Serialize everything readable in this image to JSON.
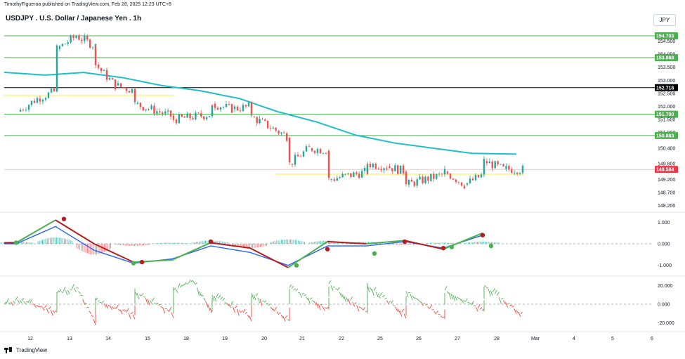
{
  "header": {
    "published": "TimothyFigueroa published on TradingView.com, Feb 28, 2025 12:23 UTC+8"
  },
  "chart_title": "USDJPY . U.S. Dollar / Japanese Yen . 1h",
  "currency_button": "JPY",
  "footer": {
    "brand": "TradingView"
  },
  "colors": {
    "up": "#26a69a",
    "down": "#ef5350",
    "ma": "#1fbfc9",
    "level_green": "#4caf50",
    "level_black": "#000000",
    "current_price": "#f23645",
    "macd_fast": "#2962ff",
    "macd_green": "#4caf50",
    "macd_red": "#b71c1c",
    "zone_yellow": "#fff59d",
    "osc_green": "#4caf50",
    "osc_red": "#f44336"
  },
  "chart_data": [
    {
      "type": "candlestick",
      "symbol": "USDJPY",
      "timeframe": "1h",
      "x_tick_labels": [
        "12",
        "13",
        "14",
        "15",
        "18",
        "19",
        "20",
        "21",
        "22",
        "25",
        "26",
        "27",
        "28",
        "Mar",
        "4",
        "5",
        "6"
      ],
      "y_tick_labels": [
        "154.500",
        "154.000",
        "153.500",
        "153.000",
        "152.500",
        "152.000",
        "151.500",
        "151.000",
        "150.400",
        "149.800",
        "149.200",
        "148.700",
        "148.200"
      ],
      "ylim": [
        148.0,
        155.0
      ],
      "price_levels": [
        {
          "label": "154.703",
          "value": 154.703,
          "color": "green"
        },
        {
          "label": "153.868",
          "value": 153.868,
          "color": "green"
        },
        {
          "label": "152.718",
          "value": 152.718,
          "color": "black"
        },
        {
          "label": "151.700",
          "value": 151.7,
          "color": "green"
        },
        {
          "label": "150.883",
          "value": 150.883,
          "color": "green"
        },
        {
          "label": "149.584",
          "value": 149.584,
          "color": "current"
        }
      ],
      "zones": [
        {
          "from_day": "12",
          "to_day": "15",
          "value": 152.42
        },
        {
          "from_day": "21",
          "to_day": "28",
          "value": 149.4
        }
      ],
      "close_path": [
        [
          "12",
          151.8
        ],
        [
          "12",
          152.3
        ],
        [
          "12",
          152.6
        ],
        [
          "13",
          154.2
        ],
        [
          "13",
          154.7
        ],
        [
          "13",
          154.3
        ],
        [
          "14",
          153.6
        ],
        [
          "14",
          152.8
        ],
        [
          "14",
          152.6
        ],
        [
          "15",
          152.1
        ],
        [
          "15",
          151.6
        ],
        [
          "18",
          151.5
        ],
        [
          "18",
          151.7
        ],
        [
          "19",
          152.1
        ],
        [
          "19",
          151.9
        ],
        [
          "19",
          152.0
        ],
        [
          "20",
          151.6
        ],
        [
          "20",
          150.8
        ],
        [
          "21",
          149.8
        ],
        [
          "21",
          150.4
        ],
        [
          "21",
          150.3
        ],
        [
          "22",
          149.2
        ],
        [
          "22",
          149.5
        ],
        [
          "25",
          149.8
        ],
        [
          "25",
          149.7
        ],
        [
          "25",
          149.5
        ],
        [
          "26",
          149.0
        ],
        [
          "26",
          149.4
        ],
        [
          "27",
          149.5
        ],
        [
          "27",
          149.0
        ],
        [
          "27",
          149.4
        ],
        [
          "28",
          149.9
        ],
        [
          "28",
          149.6
        ],
        [
          "28",
          149.58
        ]
      ],
      "moving_average": [
        [
          "12",
          153.3
        ],
        [
          "13",
          153.2
        ],
        [
          "14",
          153.3
        ],
        [
          "15",
          153.1
        ],
        [
          "18",
          152.8
        ],
        [
          "19",
          152.6
        ],
        [
          "20",
          152.3
        ],
        [
          "21",
          151.8
        ],
        [
          "22",
          151.4
        ],
        [
          "25",
          150.9
        ],
        [
          "26",
          150.6
        ],
        [
          "27",
          150.4
        ],
        [
          "28",
          150.2
        ]
      ]
    },
    {
      "type": "line",
      "name": "MACD",
      "y_tick_labels": [
        "1.000",
        "0.000",
        "-1.000"
      ],
      "ylim": [
        -1.4,
        1.4
      ],
      "fast": [
        [
          "12",
          0.0
        ],
        [
          "13",
          0.8
        ],
        [
          "14",
          -0.3
        ],
        [
          "15",
          -0.9
        ],
        [
          "18",
          -0.7
        ],
        [
          "19",
          -0.1
        ],
        [
          "20",
          -0.4
        ],
        [
          "21",
          -1.0
        ],
        [
          "22",
          -0.1
        ],
        [
          "25",
          -0.1
        ],
        [
          "26",
          0.1
        ],
        [
          "27",
          -0.2
        ],
        [
          "28",
          0.4
        ]
      ],
      "signal": [
        [
          "12",
          0.05
        ],
        [
          "13",
          1.1
        ],
        [
          "14",
          0.0
        ],
        [
          "15",
          -0.85
        ],
        [
          "18",
          -0.75
        ],
        [
          "19",
          0.05
        ],
        [
          "20",
          -0.2
        ],
        [
          "21",
          -1.1
        ],
        [
          "22",
          0.1
        ],
        [
          "25",
          0.0
        ],
        [
          "26",
          0.15
        ],
        [
          "27",
          -0.25
        ],
        [
          "28",
          0.5
        ]
      ],
      "histogram": [
        [
          "12",
          0.1
        ],
        [
          "13",
          0.3
        ],
        [
          "14",
          -0.5
        ],
        [
          "15",
          -0.1
        ],
        [
          "18",
          0.05
        ],
        [
          "19",
          0.15
        ],
        [
          "20",
          -0.2
        ],
        [
          "21",
          0.2
        ],
        [
          "22",
          0.15
        ],
        [
          "25",
          0.1
        ],
        [
          "26",
          -0.05
        ],
        [
          "27",
          0.05
        ],
        [
          "28",
          0.1
        ]
      ],
      "cross_markers": [
        [
          "12",
          0.05,
          "green"
        ],
        [
          "13",
          1.15,
          "red"
        ],
        [
          "15",
          -0.9,
          "green"
        ],
        [
          "15",
          -0.85,
          "red"
        ],
        [
          "19",
          0.1,
          "red"
        ],
        [
          "21",
          -1.0,
          "green"
        ],
        [
          "22",
          -0.25,
          "red"
        ],
        [
          "25",
          -0.45,
          "green"
        ],
        [
          "26",
          0.1,
          "red"
        ],
        [
          "27",
          -0.15,
          "green"
        ],
        [
          "27",
          -0.2,
          "red"
        ],
        [
          "28",
          -0.1,
          "green"
        ],
        [
          "28",
          0.4,
          "red"
        ]
      ]
    },
    {
      "type": "line",
      "name": "Oscillator",
      "y_tick_labels": [
        "20.000",
        "0.000",
        "-20.000"
      ],
      "ylim": [
        -28,
        28
      ],
      "values": [
        [
          "12",
          5
        ],
        [
          "12",
          -8
        ],
        [
          "13",
          12
        ],
        [
          "13",
          18
        ],
        [
          "13",
          -20
        ],
        [
          "14",
          4
        ],
        [
          "14",
          -12
        ],
        [
          "15",
          13
        ],
        [
          "15",
          -10
        ],
        [
          "18",
          15
        ],
        [
          "18",
          25
        ],
        [
          "18",
          -8
        ],
        [
          "19",
          10
        ],
        [
          "19",
          -14
        ],
        [
          "20",
          12
        ],
        [
          "20",
          -18
        ],
        [
          "21",
          18
        ],
        [
          "21",
          -6
        ],
        [
          "22",
          22
        ],
        [
          "22",
          -10
        ],
        [
          "25",
          20
        ],
        [
          "25",
          -12
        ],
        [
          "26",
          14
        ],
        [
          "26",
          -16
        ],
        [
          "27",
          15
        ],
        [
          "27",
          -8
        ],
        [
          "28",
          20
        ],
        [
          "28",
          -12
        ]
      ]
    }
  ]
}
